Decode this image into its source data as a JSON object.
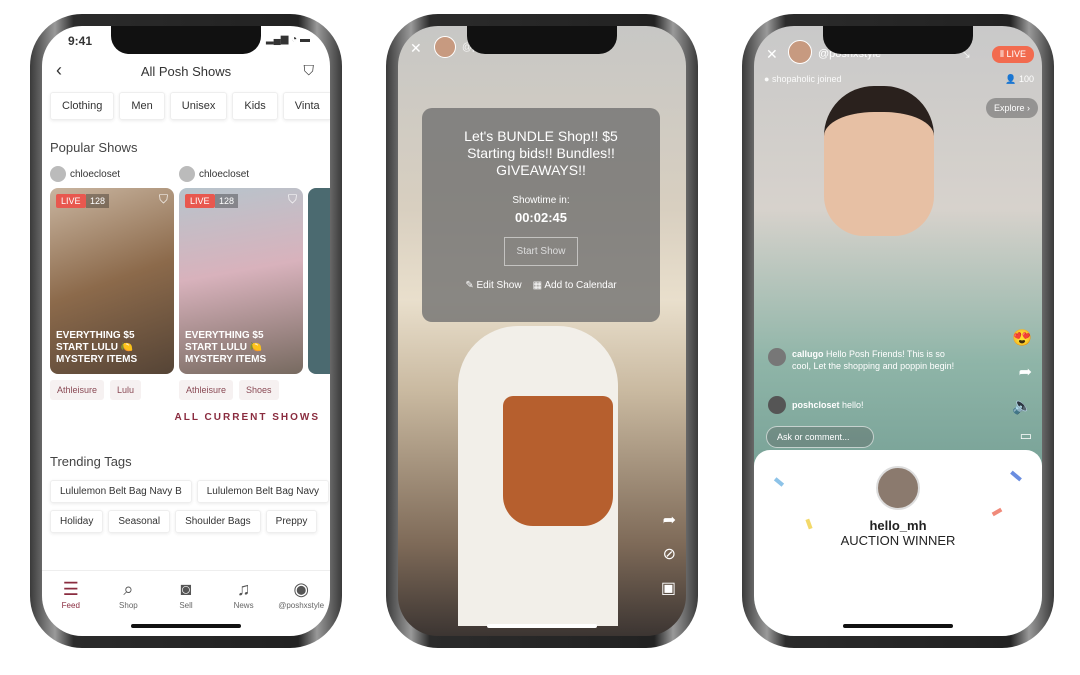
{
  "phone1": {
    "status_time": "9:41",
    "title": "All Posh Shows",
    "categories": [
      "Clothing",
      "Men",
      "Unisex",
      "Kids",
      "Vinta"
    ],
    "popular_heading": "Popular Shows",
    "shows": [
      {
        "host": "chloecloset",
        "live": "LIVE",
        "viewers": "128",
        "caption": [
          "EVERYTHING $5",
          "START LULU 🍋",
          "MYSTERY ITEMS"
        ],
        "tags": [
          "Athleisure",
          "Lulu"
        ]
      },
      {
        "host": "chloecloset",
        "live": "LIVE",
        "viewers": "128",
        "caption": [
          "EVERYTHING $5",
          "START LULU 🍋",
          "MYSTERY ITEMS"
        ],
        "tags": [
          "Athleisure",
          "Shoes"
        ]
      }
    ],
    "all_current": "ALL CURRENT SHOWS",
    "trending_heading": "Trending Tags",
    "trending_row1": [
      "Lululemon Belt Bag Navy B",
      "Lululemon Belt Bag Navy"
    ],
    "trending_row2": [
      "Holiday",
      "Seasonal",
      "Shoulder Bags",
      "Preppy"
    ],
    "nav": [
      {
        "label": "Feed",
        "icon": "feed-icon"
      },
      {
        "label": "Shop",
        "icon": "search-icon"
      },
      {
        "label": "Sell",
        "icon": "camera-icon"
      },
      {
        "label": "News",
        "icon": "bell-icon"
      },
      {
        "label": "@poshxstyle",
        "icon": "profile-icon"
      }
    ],
    "accent": "#8a2c3f"
  },
  "phone2": {
    "handle": "@poshxstyle",
    "show_title": "Let's BUNDLE Shop!! $5 Starting bids!! Bundles!! GIVEAWAYS!!",
    "showtime_label": "Showtime in:",
    "countdown": "00:02:45",
    "start_button": "Start Show",
    "edit_show": "Edit Show",
    "add_calendar": "Add to Calendar"
  },
  "phone3": {
    "handle": "@poshxstyle",
    "live": "LIVE",
    "joined": "shopaholic joined",
    "viewers": "100",
    "explore": "Explore",
    "comments": [
      {
        "user": "callugo",
        "text": "Hello Posh Friends! This is so cool, Let the shopping and poppin begin!"
      },
      {
        "user": "poshcloset",
        "text": "hello!"
      }
    ],
    "comment_placeholder": "Ask or comment...",
    "winner_name": "hello_mh",
    "winner_label": "AUCTION WINNER",
    "live_color": "#f26b4f"
  }
}
